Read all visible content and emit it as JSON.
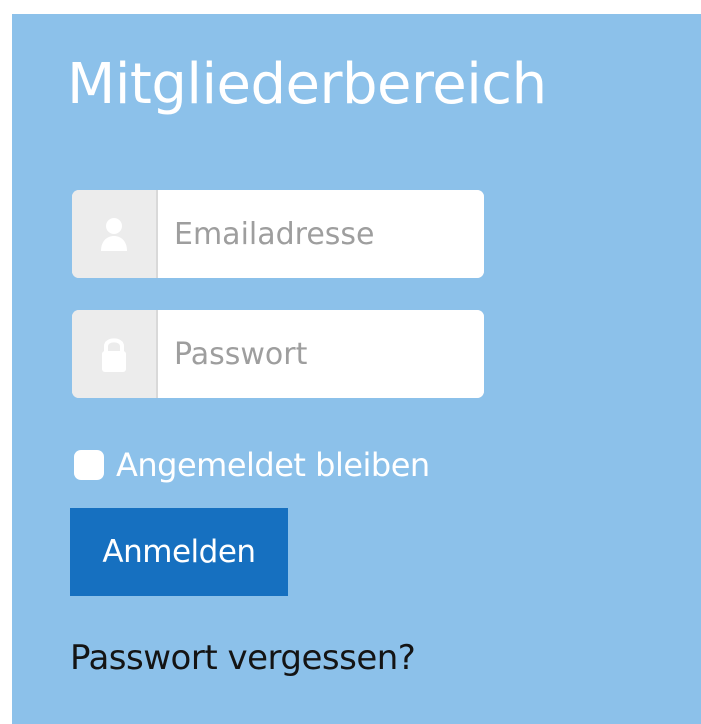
{
  "login_panel": {
    "title": "Mitgliederbereich",
    "email": {
      "icon": "user-icon",
      "value": "",
      "placeholder": "Emailadresse"
    },
    "password": {
      "icon": "lock-icon",
      "value": "",
      "placeholder": "Passwort"
    },
    "remember_me": {
      "label": "Angemeldet bleiben",
      "checked": false
    },
    "login_button_label": "Anmelden",
    "forgot_password_link": "Passwort vergessen?"
  },
  "colors": {
    "panel_background": "#8cc1ea",
    "button_background": "#1670c0",
    "addon_background": "#ececec"
  }
}
